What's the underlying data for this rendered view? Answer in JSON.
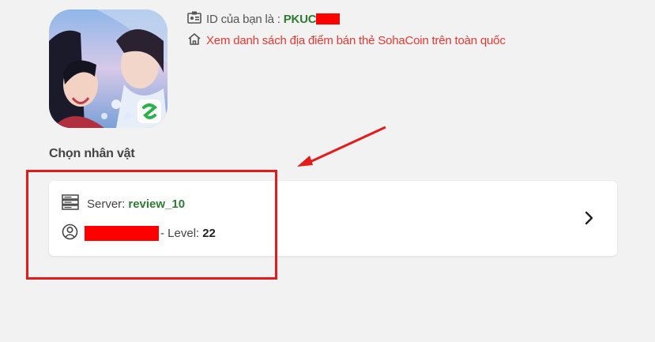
{
  "account": {
    "id_label": "ID của bạn là :",
    "id_value": "PKUC",
    "store_link": "Xem danh sách địa điểm bán thẻ SohaCoin trên toàn quốc"
  },
  "game_icon": {
    "name": "game-app-icon"
  },
  "section": {
    "title": "Chọn nhân vật"
  },
  "character": {
    "server_label": "Server:",
    "server_value": "review_10",
    "level_label": "- Level:",
    "level_value": "22"
  },
  "icons": {
    "id_card": "id-card-icon",
    "home": "home-icon",
    "server": "server-icon",
    "user": "user-circle-icon",
    "chevron": "chevron-right-icon"
  },
  "colors": {
    "accent_green": "#2e7d32",
    "link_red": "#e53935",
    "annotation_red": "#e31b1b",
    "background": "#f2f2f2"
  }
}
